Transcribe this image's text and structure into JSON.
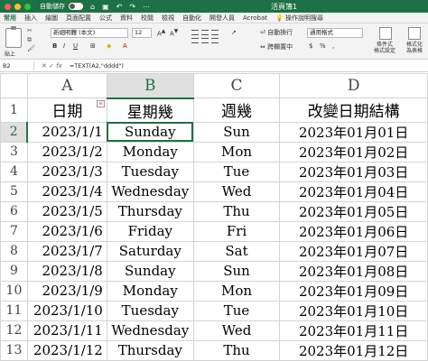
{
  "titlebar": {
    "autosave_label": "自動儲存",
    "doc_title": "活頁簿1",
    "icons": [
      "home-icon",
      "save-icon",
      "undo-icon",
      "redo-icon",
      "more-icon"
    ]
  },
  "ribbon_tabs": [
    "常用",
    "插入",
    "繪圖",
    "頁面配置",
    "公式",
    "資料",
    "校閱",
    "檢視",
    "自動化",
    "開發人員",
    "Acrobat"
  ],
  "active_tab": "常用",
  "tell_me": "操作說明搜尋",
  "ribbon": {
    "paste_label": "貼上",
    "font_name": "新細明體 (本文)",
    "font_size": "12",
    "wrap_text": "自動換行",
    "merge_center": "跨欄置中",
    "number_format": "通用格式",
    "conditional_format": "條件式\n格式設定",
    "format_as_table": "格式化\n為表格"
  },
  "formula_bar": {
    "name_box": "B2",
    "fx": "fx",
    "formula": "=TEXT(A2,\"dddd\")"
  },
  "columns": [
    "A",
    "B",
    "C",
    "D"
  ],
  "selected_column": "B",
  "selected_row": 2,
  "header_row": {
    "row": 1,
    "cells": [
      "日期",
      "星期幾",
      "週幾",
      "改變日期結構"
    ]
  },
  "rows": [
    {
      "row": 2,
      "a": "2023/1/1",
      "b": "Sunday",
      "c": "Sun",
      "d": "2023年01月01日"
    },
    {
      "row": 3,
      "a": "2023/1/2",
      "b": "Monday",
      "c": "Mon",
      "d": "2023年01月02日"
    },
    {
      "row": 4,
      "a": "2023/1/3",
      "b": "Tuesday",
      "c": "Tue",
      "d": "2023年01月03日"
    },
    {
      "row": 5,
      "a": "2023/1/4",
      "b": "Wednesday",
      "c": "Wed",
      "d": "2023年01月04日"
    },
    {
      "row": 6,
      "a": "2023/1/5",
      "b": "Thursday",
      "c": "Thu",
      "d": "2023年01月05日"
    },
    {
      "row": 7,
      "a": "2023/1/6",
      "b": "Friday",
      "c": "Fri",
      "d": "2023年01月06日"
    },
    {
      "row": 8,
      "a": "2023/1/7",
      "b": "Saturday",
      "c": "Sat",
      "d": "2023年01月07日"
    },
    {
      "row": 9,
      "a": "2023/1/8",
      "b": "Sunday",
      "c": "Sun",
      "d": "2023年01月08日"
    },
    {
      "row": 10,
      "a": "2023/1/9",
      "b": "Monday",
      "c": "Mon",
      "d": "2023年01月09日"
    },
    {
      "row": 11,
      "a": "2023/1/10",
      "b": "Tuesday",
      "c": "Tue",
      "d": "2023年01月10日"
    },
    {
      "row": 12,
      "a": "2023/1/11",
      "b": "Wednesday",
      "c": "Wed",
      "d": "2023年01月11日"
    },
    {
      "row": 13,
      "a": "2023/1/12",
      "b": "Thursday",
      "c": "Thu",
      "d": "2023年01月12日"
    }
  ],
  "colors": {
    "accent": "#1e7145"
  }
}
